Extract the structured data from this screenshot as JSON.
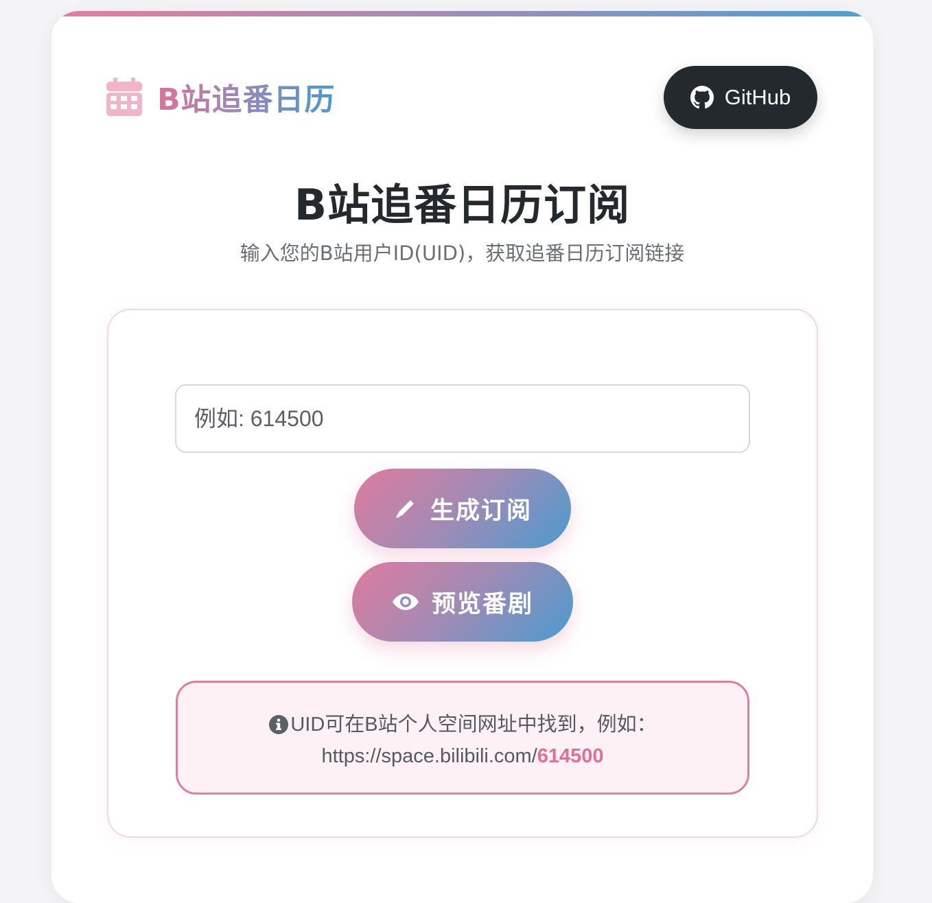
{
  "brand": {
    "title": "B站追番日历",
    "icon": "calendar-icon"
  },
  "header": {
    "github_label": "GitHub",
    "github_icon": "github-icon"
  },
  "main": {
    "title": "B站追番日历订阅",
    "subtitle": "输入您的B站用户ID(UID)，获取追番日历订阅链接"
  },
  "form": {
    "uid_placeholder": "例如: 614500",
    "uid_value": "",
    "generate_label": "生成订阅",
    "generate_icon": "pencil-icon",
    "preview_label": "预览番剧",
    "preview_icon": "eye-icon"
  },
  "hint": {
    "icon": "info-icon",
    "line1": "UID可在B站个人空间网址中找到，例如：",
    "url_prefix": "https://space.bilibili.com/",
    "url_uid": "614500"
  },
  "colors": {
    "accent_pink": "#e07b9e",
    "accent_blue": "#4a9bd0",
    "dark": "#24292e",
    "hint_bg": "#fdf1f5"
  }
}
